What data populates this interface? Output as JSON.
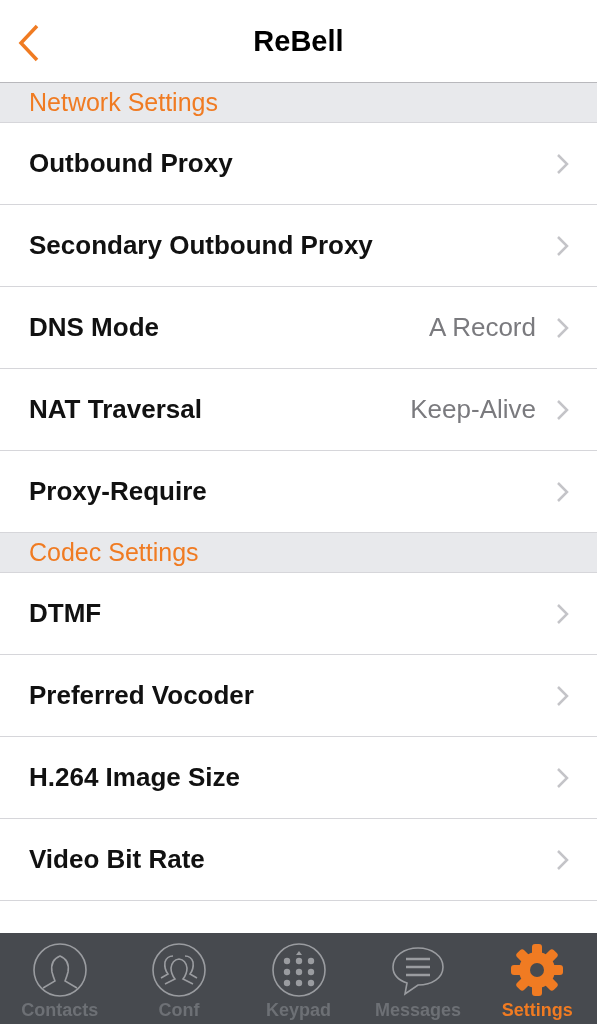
{
  "nav": {
    "title": "ReBell"
  },
  "sections": [
    {
      "title": "Network Settings",
      "rows": [
        {
          "label": "Outbound Proxy"
        },
        {
          "label": "Secondary Outbound Proxy"
        },
        {
          "label": "DNS Mode",
          "value": "A Record"
        },
        {
          "label": "NAT Traversal",
          "value": "Keep-Alive"
        },
        {
          "label": "Proxy-Require"
        }
      ]
    },
    {
      "title": "Codec Settings",
      "rows": [
        {
          "label": "DTMF"
        },
        {
          "label": "Preferred Vocoder"
        },
        {
          "label": "H.264 Image Size"
        },
        {
          "label": "Video Bit Rate"
        }
      ]
    }
  ],
  "tabs": [
    {
      "kind": "contacts",
      "label": "Contacts",
      "selected": false
    },
    {
      "kind": "conf",
      "label": "Conf",
      "selected": false
    },
    {
      "kind": "keypad",
      "label": "Keypad",
      "selected": false
    },
    {
      "kind": "messages",
      "label": "Messages",
      "selected": false
    },
    {
      "kind": "settings",
      "label": "Settings",
      "selected": true
    }
  ]
}
